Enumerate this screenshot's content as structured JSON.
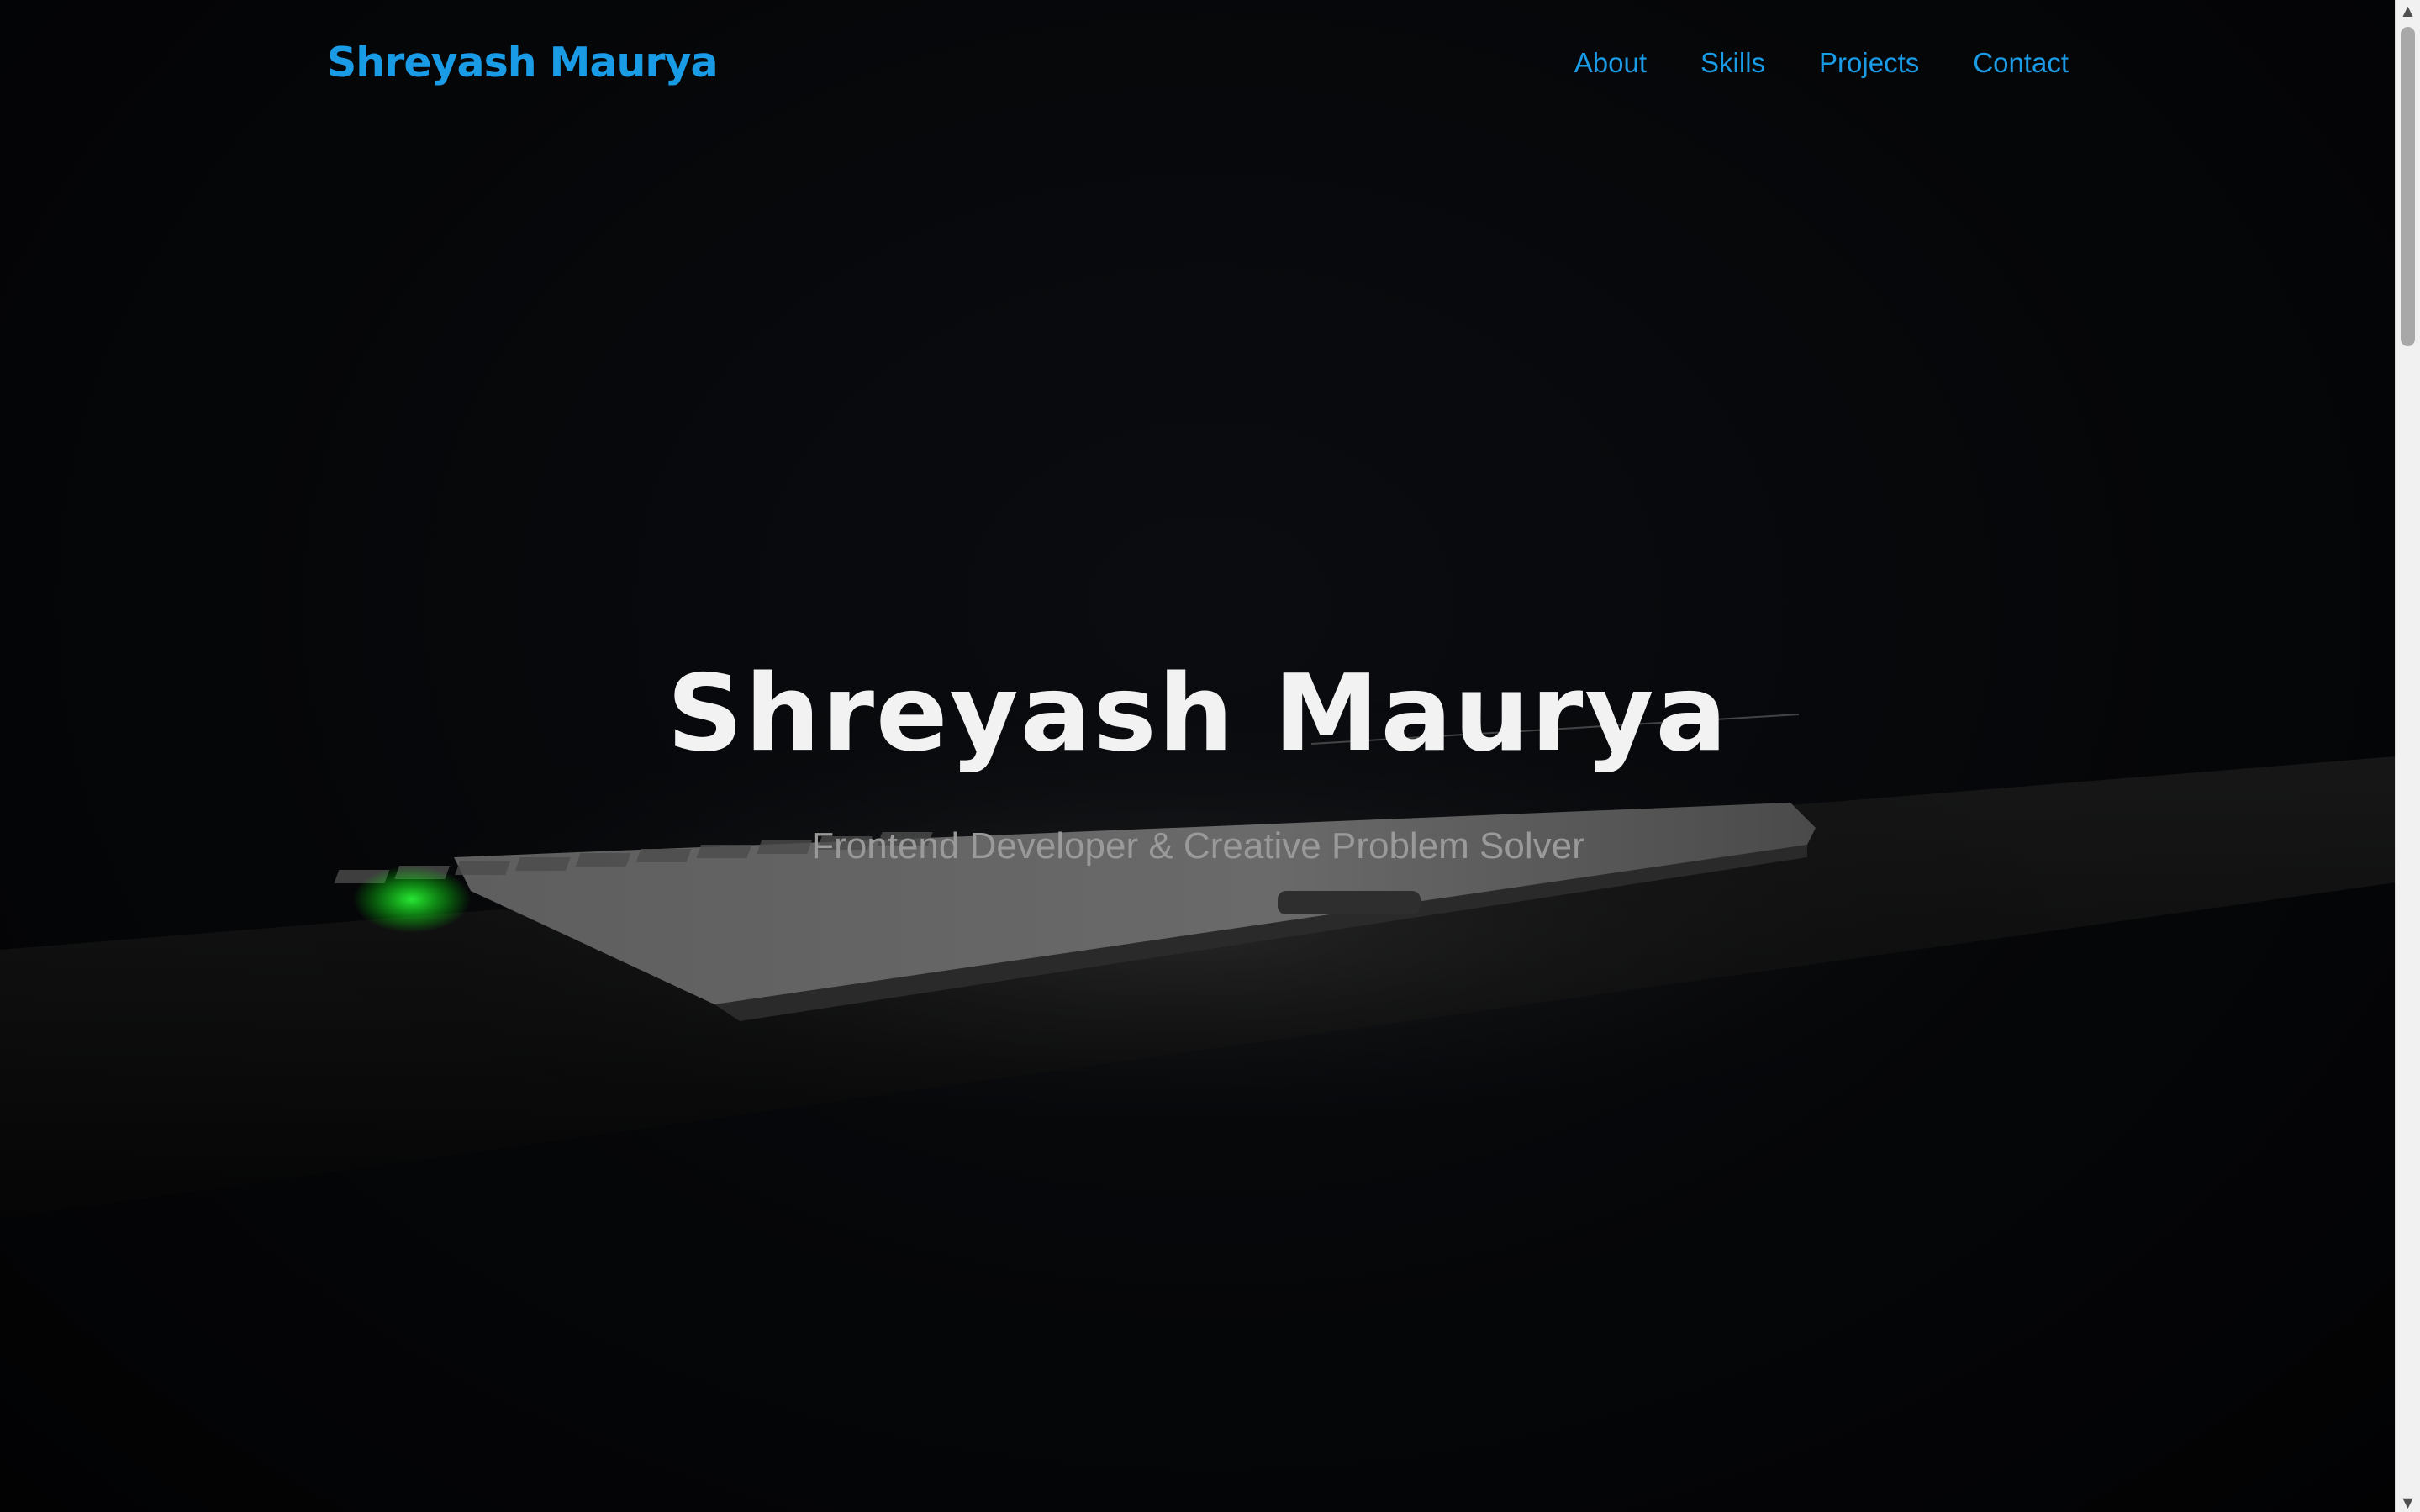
{
  "header": {
    "logo_text": "Shreyash Maurya",
    "nav": [
      {
        "label": "About"
      },
      {
        "label": "Skills"
      },
      {
        "label": "Projects"
      },
      {
        "label": "Contact"
      }
    ]
  },
  "hero": {
    "title": "Shreyash Maurya",
    "subtitle": "Frontend Developer & Creative Problem Solver"
  },
  "scrollbar": {
    "up_icon": "chevron-up",
    "down_icon": "chevron-down"
  },
  "colors": {
    "accent": "#1a9be6",
    "background": "#050608",
    "title": "#f2f2f2",
    "subtitle": "#9a9a9a"
  }
}
